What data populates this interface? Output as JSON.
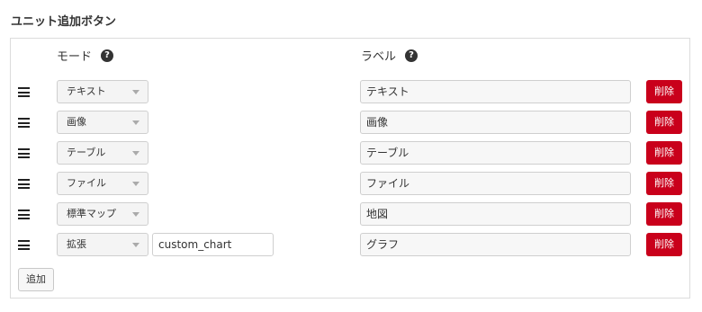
{
  "section": {
    "title": "ユニット追加ボタン"
  },
  "columns": {
    "mode": "モード",
    "label": "ラベル",
    "help_glyph": "?"
  },
  "rows": [
    {
      "mode": "テキスト",
      "label": "テキスト",
      "extra": null,
      "delete": "削除"
    },
    {
      "mode": "画像",
      "label": "画像",
      "extra": null,
      "delete": "削除"
    },
    {
      "mode": "テーブル",
      "label": "テーブル",
      "extra": null,
      "delete": "削除"
    },
    {
      "mode": "ファイル",
      "label": "ファイル",
      "extra": null,
      "delete": "削除"
    },
    {
      "mode": "標準マップ",
      "label": "地図",
      "extra": null,
      "delete": "削除"
    },
    {
      "mode": "拡張",
      "label": "グラフ",
      "extra": "custom_chart",
      "delete": "削除"
    }
  ],
  "add_button": {
    "label": "追加"
  },
  "colors": {
    "delete": "#c9001b",
    "help": "#333333"
  }
}
